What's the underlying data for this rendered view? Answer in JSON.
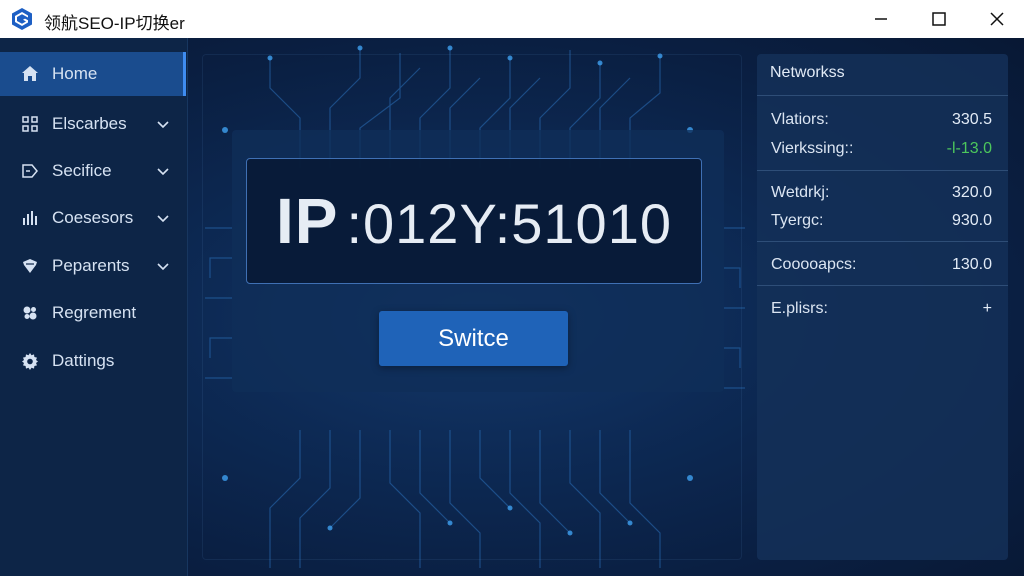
{
  "window": {
    "title": "领航SEO-IP切换er"
  },
  "sidebar": {
    "items": [
      {
        "label": "Home",
        "icon": "home-icon",
        "active": true,
        "expandable": false
      },
      {
        "label": "Elscarbes",
        "icon": "grid-icon",
        "active": false,
        "expandable": true
      },
      {
        "label": "Secifice",
        "icon": "tag-icon",
        "active": false,
        "expandable": true
      },
      {
        "label": "Coesesors",
        "icon": "bar-chart-icon",
        "active": false,
        "expandable": true
      },
      {
        "label": "Peparents",
        "icon": "shield-icon",
        "active": false,
        "expandable": true
      },
      {
        "label": "Regrement",
        "icon": "cog-cluster-icon",
        "active": false,
        "expandable": false
      },
      {
        "label": "Dattings",
        "icon": "gear-icon",
        "active": false,
        "expandable": false
      }
    ]
  },
  "main": {
    "ip_prefix": "IP",
    "ip_value": ":012Y:51010",
    "switch_label": "Switce"
  },
  "network": {
    "title": "Networkss",
    "rows": [
      {
        "label": "Vlatiors:",
        "value": "330.5",
        "color": "#e2ebf6"
      },
      {
        "label": "Vierkssing::",
        "value": "-l-13.0",
        "color": "#4cc75c"
      },
      {
        "label": "Wetdrkj:",
        "value": "320.0",
        "color": "#e2ebf6"
      },
      {
        "label": "Tyergc:",
        "value": "930.0",
        "color": "#e2ebf6"
      },
      {
        "label": "Cooooapcs:",
        "value": "130.0",
        "color": "#e2ebf6"
      },
      {
        "label": "E.plisrs:",
        "value": "+",
        "color": "#e2ebf6"
      }
    ]
  },
  "colors": {
    "accent": "#1f63b8",
    "active_nav": "#1a4c8e",
    "positive": "#4cc75c",
    "logo": "#1d5fc4"
  }
}
